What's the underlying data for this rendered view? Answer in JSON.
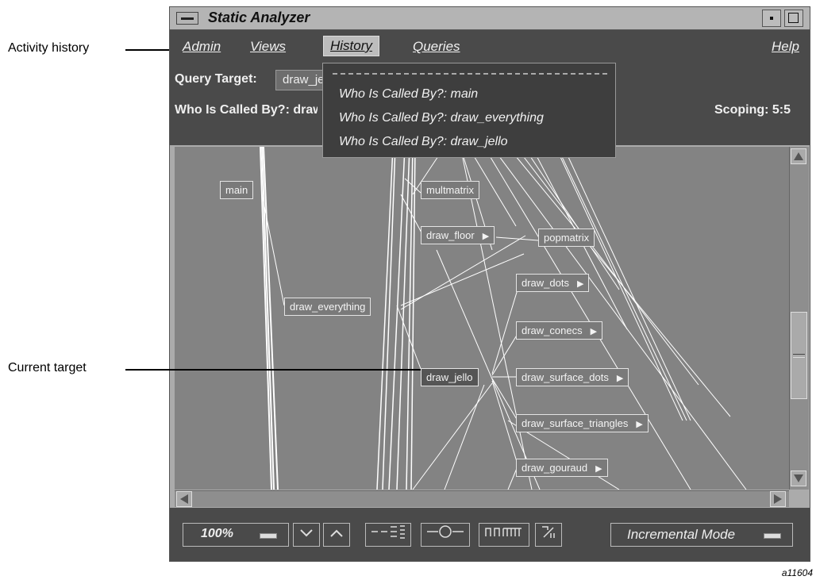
{
  "callouts": {
    "activity_history": "Activity history",
    "current_target": "Current target"
  },
  "figure_id": "a11604",
  "window": {
    "title": "Static Analyzer"
  },
  "menubar": {
    "admin": "Admin",
    "views": "Views",
    "history": "History",
    "queries": "Queries",
    "help": "Help"
  },
  "info": {
    "query_target_label": "Query Target:",
    "query_target_value": "draw_jello",
    "query_result_label": "Who Is Called By?: draw_jello",
    "scoping": "Scoping: 5:5"
  },
  "history_menu": {
    "items": [
      "Who Is Called By?: main",
      "Who Is Called By?: draw_everything",
      "Who Is Called By?: draw_jello"
    ]
  },
  "graph": {
    "nodes": {
      "main": "main",
      "multmatrix": "multmatrix",
      "draw_floor": "draw_floor",
      "popmatrix": "popmatrix",
      "draw_dots": "draw_dots",
      "draw_everything": "draw_everything",
      "draw_conecs": "draw_conecs",
      "draw_jello": "draw_jello",
      "draw_surface_dots": "draw_surface_dots",
      "draw_surface_triangles": "draw_surface_triangles",
      "draw_gouraud": "draw_gouraud"
    },
    "expand_arrow": "▶"
  },
  "toolbar": {
    "zoom": "100%",
    "incremental_mode": "Incremental Mode"
  },
  "colors": {
    "chrome": "#4a4a4a",
    "graph_bg": "#838383",
    "edge": "#ffffff"
  }
}
